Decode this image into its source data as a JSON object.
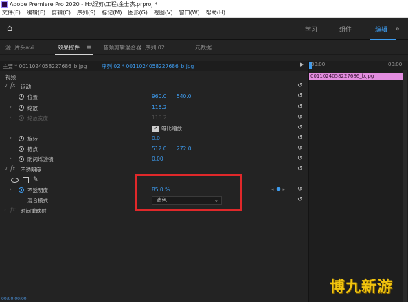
{
  "window": {
    "title": "Adobe Premiere Pro 2020 - H:\\混剪\\工程\\金士杰.prproj *"
  },
  "menu": {
    "items": [
      "文件(F)",
      "编辑(E)",
      "剪辑(C)",
      "序列(S)",
      "标记(M)",
      "图形(G)",
      "视图(V)",
      "窗口(W)",
      "帮助(H)"
    ]
  },
  "workspaces": {
    "items": [
      "学习",
      "组件",
      "编辑"
    ],
    "active": "编辑"
  },
  "panel_tabs": {
    "source": "源: 片头avi",
    "effect_controls": "效果控件",
    "effect_controls_menu": "≡",
    "audio_mixer": "音频剪辑混合器: 序列 02",
    "metadata": "元数据"
  },
  "effect_controls": {
    "master": "主要 * 0011024058227686_b.jpg",
    "sequence": "序列 02 * 0011024058227686_b.jpg",
    "section_video": "视频",
    "motion": {
      "title": "运动",
      "position": {
        "label": "位置",
        "x": "960.0",
        "y": "540.0"
      },
      "scale": {
        "label": "缩放",
        "value": "116.2"
      },
      "scale_width": {
        "label": "缩放宽度",
        "value": "116.2"
      },
      "uniform_scale": {
        "label": "等比缩放",
        "checked": true
      },
      "rotation": {
        "label": "旋转",
        "value": "0.0"
      },
      "anchor": {
        "label": "锚点",
        "x": "512.0",
        "y": "272.0"
      },
      "anti_flicker": {
        "label": "防闪烁滤镜",
        "value": "0.00"
      }
    },
    "opacity": {
      "title": "不透明度",
      "opacity": {
        "label": "不透明度",
        "value": "85.0 %"
      },
      "blend_mode": {
        "label": "混合模式",
        "value": "滤色"
      }
    },
    "time_remap": {
      "title": "时间重映射"
    }
  },
  "timeline": {
    "ruler_start": "00:00",
    "ruler_end": "00:00",
    "clip_name": "0011024058227686_b.jpg",
    "timecode": "00:00:00:00"
  },
  "watermark": "博九新游",
  "colors": {
    "accent": "#3d9cf0",
    "highlight": "#e0282a",
    "clip": "#e38ee0"
  }
}
